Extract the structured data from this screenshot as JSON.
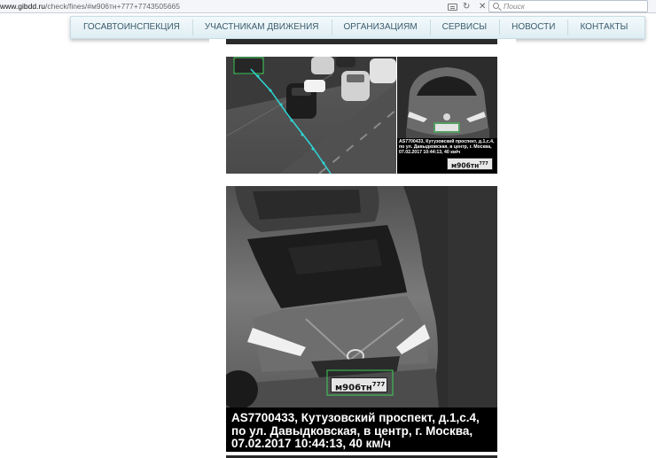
{
  "browser": {
    "url_host": "www.gibdd.ru",
    "url_path": "/check/fines/#м906тн+777+7743505665",
    "search_placeholder": "Поиск"
  },
  "nav": {
    "items": [
      "ГОСАВТОИНСПЕКЦИЯ",
      "УЧАСТНИКАМ ДВИЖЕНИЯ",
      "ОРГАНИЗАЦИЯМ",
      "СЕРВИСЫ",
      "НОВОСТИ",
      "КОНТАКТЫ"
    ]
  },
  "photos": {
    "caption_lines": [
      "AS7700433, Кутузовский проспект, д.1,с.4,",
      "по ул. Давыдковская, в центр, г. Москва,",
      "07.02.2017 10:44:13, 40 км/ч"
    ],
    "plate_number": "м906тн",
    "plate_region": "777"
  }
}
